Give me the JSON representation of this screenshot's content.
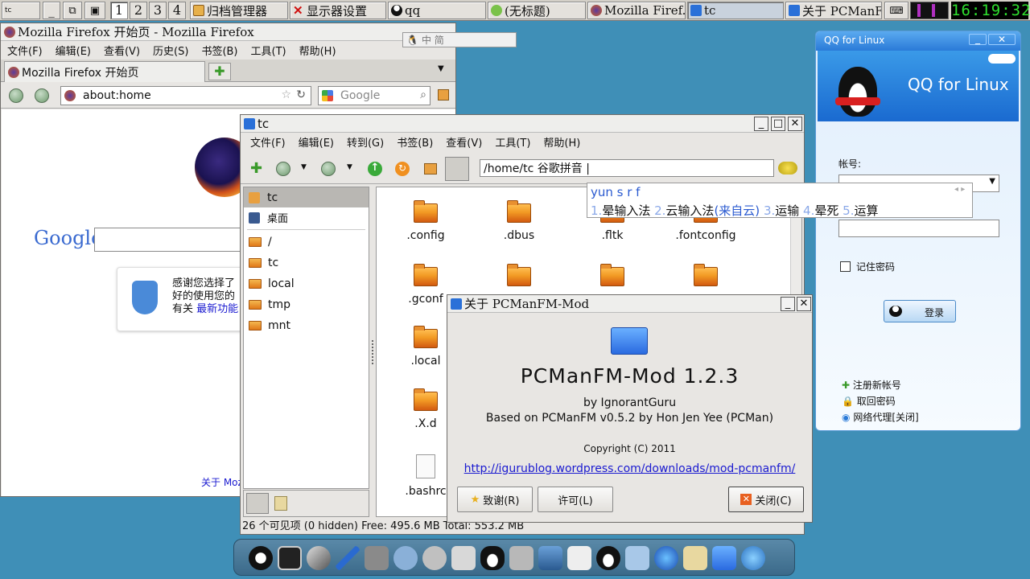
{
  "taskbar": {
    "desktops": [
      "1",
      "2",
      "3",
      "4"
    ],
    "tasks": [
      {
        "label": "归档管理器"
      },
      {
        "label": "显示器设置"
      },
      {
        "label": "qq"
      },
      {
        "label": "(无标题)"
      },
      {
        "label": "Mozilla Firef..."
      },
      {
        "label": "tc"
      },
      {
        "label": "关于 PCManF..."
      }
    ],
    "clock": "16:19:32"
  },
  "firefox": {
    "title": "Mozilla Firefox 开始页 - Mozilla Firefox",
    "menus": [
      "文件(F)",
      "编辑(E)",
      "查看(V)",
      "历史(S)",
      "书签(B)",
      "工具(T)",
      "帮助(H)"
    ],
    "tab_label": "Mozilla Firefox 开始页",
    "url": "about:home",
    "search_placeholder": "Google",
    "google_logo": "Google",
    "snippet_line1": "感谢您选择了",
    "snippet_line2": "好的使用您的",
    "snippet_line3": "有关",
    "snippet_link": "最新功能",
    "footer_link": "关于 Moz"
  },
  "ime_bar": {
    "label": "中 简"
  },
  "fm": {
    "title": "tc",
    "menus": [
      "文件(F)",
      "编辑(E)",
      "转到(G)",
      "书签(B)",
      "查看(V)",
      "工具(T)",
      "帮助(H)"
    ],
    "address": "/home/tc 谷歌拼音 |",
    "sidebar_top": [
      {
        "label": "tc"
      },
      {
        "label": "桌面"
      }
    ],
    "sidebar_places": [
      {
        "label": "/"
      },
      {
        "label": "tc"
      },
      {
        "label": "local"
      },
      {
        "label": "tmp"
      },
      {
        "label": "mnt"
      }
    ],
    "files": [
      {
        "name": ".config"
      },
      {
        "name": ".dbus"
      },
      {
        "name": ".fltk"
      },
      {
        "name": ".fontconfig"
      },
      {
        "name": ".gconf"
      },
      {
        "name": ""
      },
      {
        "name": ""
      },
      {
        "name": ""
      },
      {
        "name": ".local"
      },
      {
        "name": ".X.d"
      },
      {
        "name": ".bashrc"
      }
    ],
    "status": "26 个可见项 (0 hidden) Free: 495.6 MB Total: 553.2 MB"
  },
  "ime_popup": {
    "input": "yun s r f",
    "candidates": [
      {
        "num": "1.",
        "text": "晕输入法"
      },
      {
        "num": "2.",
        "text": "云输入法"
      },
      {
        "num": "",
        "text": "(来自云)"
      },
      {
        "num": "3.",
        "text": "运输"
      },
      {
        "num": "4.",
        "text": "晕死"
      },
      {
        "num": "5.",
        "text": "运算"
      }
    ]
  },
  "about": {
    "title": "关于 PCManFM-Mod",
    "name": "PCManFM-Mod 1.2.3",
    "author": "by IgnorantGuru",
    "based": "Based on PCManFM v0.5.2 by Hon Jen Yee (PCMan)",
    "copyright": "Copyright (C) 2011",
    "link": "http://igurublog.wordpress.com/downloads/mod-pcmanfm/",
    "btn_credits": "致谢(R)",
    "btn_license": "许可(L)",
    "btn_close": "关闭(C)"
  },
  "qq": {
    "title": "QQ for Linux",
    "banner": "QQ for Linux",
    "account_label": "帐号:",
    "remember": "记住密码",
    "login": "登录",
    "links": [
      "注册新帐号",
      "取回密码",
      "网络代理[关闭]"
    ]
  },
  "colors": {
    "desktop": "#3f8fb7",
    "link": "#1a1ad0",
    "ime_text": "#2a5ad0"
  }
}
